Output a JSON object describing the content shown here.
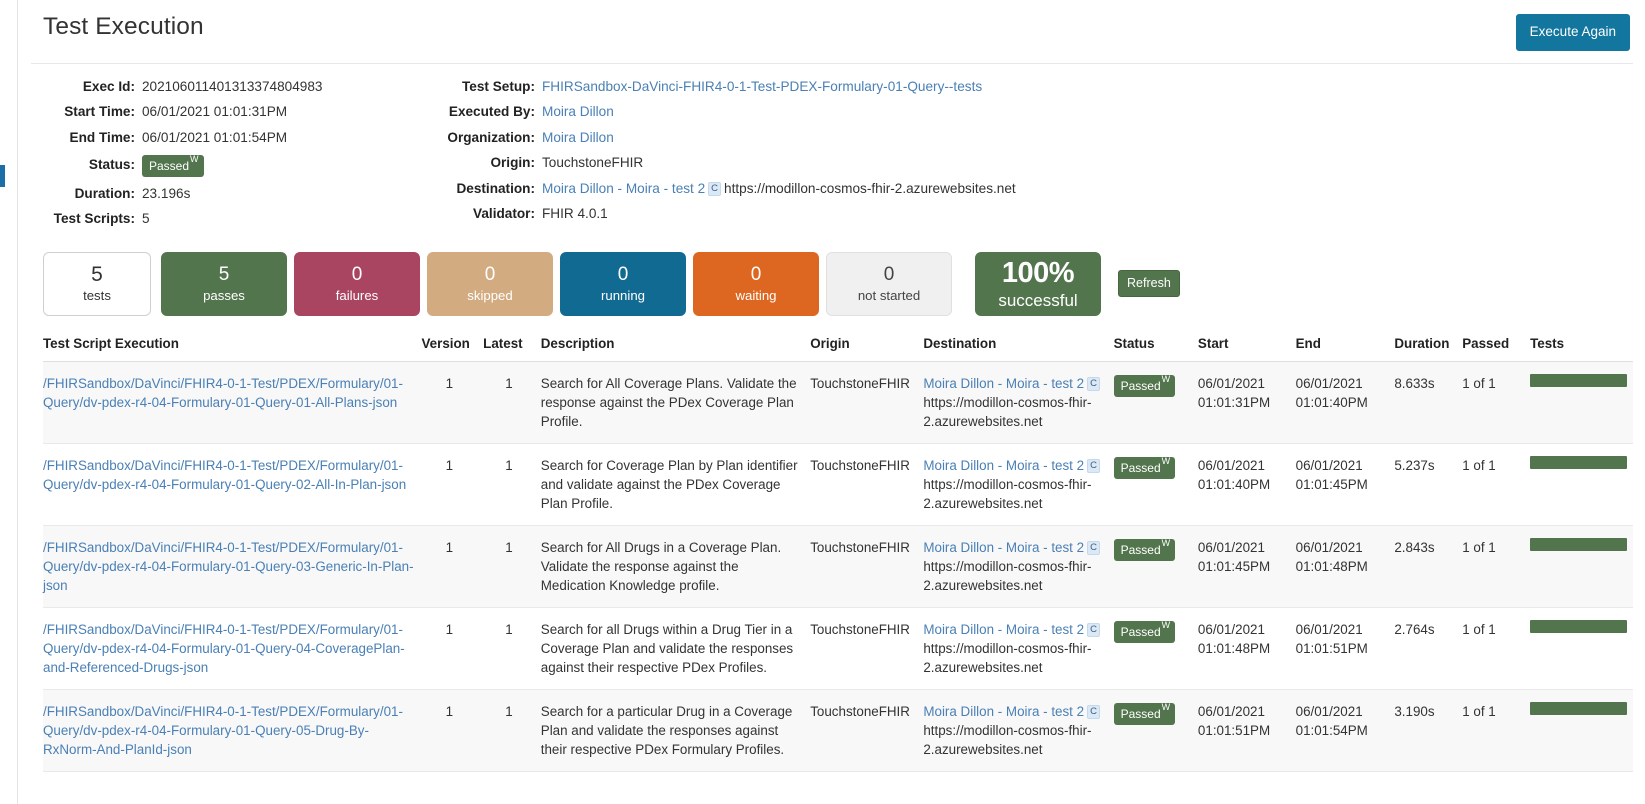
{
  "header": {
    "title": "Test Execution",
    "execute_again_label": "Execute Again"
  },
  "details": {
    "left": [
      {
        "label": "Exec Id:",
        "value": "20210601140131337480498​3"
      },
      {
        "label": "Start Time:",
        "value": "06/01/2021 01:01:31PM"
      },
      {
        "label": "End Time:",
        "value": "06/01/2021 01:01:54PM"
      },
      {
        "label": "Status:",
        "value": "Passed",
        "badge_sup": "W"
      },
      {
        "label": "Duration:",
        "value": "23.196s"
      },
      {
        "label": "Test Scripts:",
        "value": "5"
      }
    ],
    "exec_id_label": "Exec Id:",
    "exec_id_value": "20210601140131337480498​3",
    "start_time_label": "Start Time:",
    "start_time_value": "06/01/2021 01:01:31PM",
    "end_time_label": "End Time:",
    "end_time_value": "06/01/2021 01:01:54PM",
    "status_label": "Status:",
    "status_value": "Passed",
    "status_sup": "W",
    "duration_label": "Duration:",
    "duration_value": "23.196s",
    "test_scripts_label": "Test Scripts:",
    "test_scripts_value": "5",
    "test_setup_label": "Test Setup:",
    "test_setup_value": "FHIRSandbox-DaVinci-FHIR4-0-1-Test-PDEX-Formulary-01-Query--tests",
    "executed_by_label": "Executed By:",
    "executed_by_value": "Moira Dillon",
    "organization_label": "Organization:",
    "organization_value": "Moira Dillon",
    "origin_label": "Origin:",
    "origin_value": "TouchstoneFHIR",
    "destination_label": "Destination:",
    "destination_name": "Moira Dillon - Moira - test 2",
    "destination_badge": "C",
    "destination_url": "https://modillon-cosmos-fhir-2.azurewebsites.net",
    "validator_label": "Validator:",
    "validator_value": "FHIR 4.0.1"
  },
  "stats": {
    "refresh_label": "Refresh",
    "boxes": [
      {
        "num": "5",
        "label": "tests",
        "color": "#ffffff"
      },
      {
        "num": "5",
        "label": "passes",
        "color": "#53754d"
      },
      {
        "num": "0",
        "label": "failures",
        "color": "#a94561"
      },
      {
        "num": "0",
        "label": "skipped",
        "color": "#d3ab80"
      },
      {
        "num": "0",
        "label": "running",
        "color": "#106a91"
      },
      {
        "num": "0",
        "label": "waiting",
        "color": "#dd6720"
      },
      {
        "num": "0",
        "label": "not started",
        "color": "#f0f0f0"
      }
    ],
    "percent": {
      "num": "100%",
      "label": "successful",
      "color": "#53754d"
    }
  },
  "table": {
    "columns": [
      "Test Script Execution",
      "Version",
      "Latest",
      "Description",
      "Origin",
      "Destination",
      "Status",
      "Start",
      "End",
      "Duration",
      "Passed",
      "Tests"
    ],
    "rows": [
      {
        "script": "/FHIRSandbox/DaVinci/FHIR4-0-1-Test/PDEX/Formulary/01-Query/dv-pdex-r4-04-Formulary-01-Query-01-All-Plans-json",
        "version": "1",
        "latest": "1",
        "description": "Search for All Coverage Plans. Validate the response against the PDex Coverage Plan Profile.",
        "origin": "TouchstoneFHIR",
        "dest_name": "Moira Dillon - Moira - test 2",
        "dest_badge": "C",
        "dest_url": "https://modillon-cosmos-fhir-2.azurewebsites.net",
        "status": "Passed",
        "status_sup": "W",
        "start_date": "06/01/2021",
        "start_time": "01:01:31PM",
        "end_date": "06/01/2021",
        "end_time": "01:01:40PM",
        "duration": "8.633s",
        "passed": "1 of 1"
      },
      {
        "script": "/FHIRSandbox/DaVinci/FHIR4-0-1-Test/PDEX/Formulary/01-Query/dv-pdex-r4-04-Formulary-01-Query-02-All-In-Plan-json",
        "version": "1",
        "latest": "1",
        "description": "Search for Coverage Plan by Plan identifier and validate against the PDex Coverage Plan Profile.",
        "origin": "TouchstoneFHIR",
        "dest_name": "Moira Dillon - Moira - test 2",
        "dest_badge": "C",
        "dest_url": "https://modillon-cosmos-fhir-2.azurewebsites.net",
        "status": "Passed",
        "status_sup": "W",
        "start_date": "06/01/2021",
        "start_time": "01:01:40PM",
        "end_date": "06/01/2021",
        "end_time": "01:01:45PM",
        "duration": "5.237s",
        "passed": "1 of 1"
      },
      {
        "script": "/FHIRSandbox/DaVinci/FHIR4-0-1-Test/PDEX/Formulary/01-Query/dv-pdex-r4-04-Formulary-01-Query-03-Generic-In-Plan-json",
        "version": "1",
        "latest": "1",
        "description": "Search for All Drugs in a Coverage Plan. Validate the response against the Medication Knowledge profile.",
        "origin": "TouchstoneFHIR",
        "dest_name": "Moira Dillon - Moira - test 2",
        "dest_badge": "C",
        "dest_url": "https://modillon-cosmos-fhir-2.azurewebsites.net",
        "status": "Passed",
        "status_sup": "W",
        "start_date": "06/01/2021",
        "start_time": "01:01:45PM",
        "end_date": "06/01/2021",
        "end_time": "01:01:48PM",
        "duration": "2.843s",
        "passed": "1 of 1"
      },
      {
        "script": "/FHIRSandbox/DaVinci/FHIR4-0-1-Test/PDEX/Formulary/01-Query/dv-pdex-r4-04-Formulary-01-Query-04-CoveragePlan-and-Referenced-Drugs-json",
        "version": "1",
        "latest": "1",
        "description": "Search for all Drugs within a Drug Tier in a Coverage Plan and validate the responses against their respective PDex Profiles.",
        "origin": "TouchstoneFHIR",
        "dest_name": "Moira Dillon - Moira - test 2",
        "dest_badge": "C",
        "dest_url": "https://modillon-cosmos-fhir-2.azurewebsites.net",
        "status": "Passed",
        "status_sup": "W",
        "start_date": "06/01/2021",
        "start_time": "01:01:48PM",
        "end_date": "06/01/2021",
        "end_time": "01:01:51PM",
        "duration": "2.764s",
        "passed": "1 of 1"
      },
      {
        "script": "/FHIRSandbox/DaVinci/FHIR4-0-1-Test/PDEX/Formulary/01-Query/dv-pdex-r4-04-Formulary-01-Query-05-Drug-By-RxNorm-And-PlanId-json",
        "version": "1",
        "latest": "1",
        "description": "Search for a particular Drug in a Coverage Plan and validate the responses against their respective PDex Formulary Profiles.",
        "origin": "TouchstoneFHIR",
        "dest_name": "Moira Dillon - Moira - test 2",
        "dest_badge": "C",
        "dest_url": "https://modillon-cosmos-fhir-2.azurewebsites.net",
        "status": "Passed",
        "status_sup": "W",
        "start_date": "06/01/2021",
        "start_time": "01:01:51PM",
        "end_date": "06/01/2021",
        "end_time": "01:01:54PM",
        "duration": "3.190s",
        "passed": "1 of 1"
      }
    ]
  },
  "colors": {
    "accent_blue": "#12769e",
    "link_blue": "#4a80b5",
    "pass_green": "#53754d",
    "fail_red": "#a94561",
    "skip_tan": "#d3ab80",
    "running_blue": "#106a91",
    "waiting_orange": "#dd6720"
  }
}
